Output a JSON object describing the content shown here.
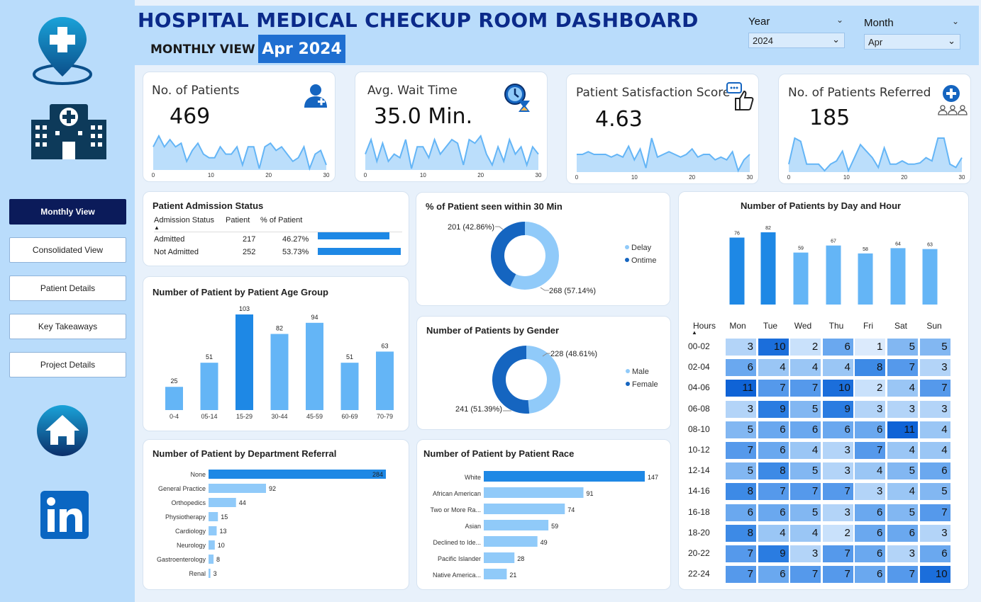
{
  "header": {
    "title": "HOSPITAL MEDICAL CHECKUP ROOM  DASHBOARD",
    "view_label": "MONTHLY VIEW",
    "period": "Apr 2024"
  },
  "filters": {
    "year": {
      "label": "Year",
      "value": "2024"
    },
    "month": {
      "label": "Month",
      "value": "Apr"
    }
  },
  "nav": {
    "items": [
      "Monthly View",
      "Consolidated View",
      "Patient Details",
      "Key Takeaways",
      "Project Details"
    ],
    "active": 0
  },
  "kpis": [
    {
      "title": "No. of Patients",
      "value": "469",
      "icon": "patient-icon",
      "ticks": [
        "0",
        "10",
        "20",
        "30"
      ]
    },
    {
      "title": "Avg. Wait Time",
      "value": "35.0 Min.",
      "icon": "clock-hourglass-icon",
      "ticks": [
        "0",
        "10",
        "20",
        "30"
      ]
    },
    {
      "title": "Patient Satisfaction Score",
      "value": "4.63",
      "icon": "feedback-thumbs-up-icon",
      "ticks": [
        "0",
        "10",
        "20",
        "30"
      ]
    },
    {
      "title": "No. of Patients Referred",
      "value": "185",
      "icon": "referral-group-icon",
      "ticks": [
        "0",
        "10",
        "20",
        "30"
      ]
    }
  ],
  "admission": {
    "title": "Patient Admission Status",
    "headers": [
      "Admission Status",
      "Patient",
      "% of Patient"
    ],
    "rows": [
      {
        "status": "Admitted",
        "patients": "217",
        "pct": "46.27%",
        "frac": 0.4627
      },
      {
        "status": "Not Admitted",
        "patients": "252",
        "pct": "53.73%",
        "frac": 0.5373
      }
    ]
  },
  "colors": {
    "dark": "#1565c0",
    "mid": "#1e88e5",
    "light": "#64b5f6",
    "lighter": "#90caf9",
    "pale": "#bbdefb"
  },
  "chart_data": [
    {
      "id": "kpi-patients",
      "type": "area",
      "x_range": [
        0,
        30
      ],
      "values": [
        6,
        7.5,
        6,
        7,
        6,
        6.5,
        4,
        5.5,
        6.5,
        5,
        4.5,
        4.5,
        6,
        5,
        5,
        6,
        3.5,
        6,
        6,
        3,
        6,
        6.5,
        5.5,
        6,
        5,
        4,
        4.5,
        6,
        3,
        5,
        5.5,
        3.5
      ]
    },
    {
      "id": "kpi-wait",
      "type": "area",
      "x_range": [
        0,
        30
      ],
      "values": [
        5,
        7,
        4,
        6.5,
        4,
        5,
        4.5,
        7,
        3,
        6,
        6,
        4.5,
        7,
        5,
        6,
        7,
        6.5,
        3.5,
        7,
        6.5,
        7.5,
        5,
        3.5,
        6,
        4,
        7,
        5,
        6,
        3.5,
        6,
        5
      ]
    },
    {
      "id": "kpi-satisfaction",
      "type": "area",
      "x_range": [
        0,
        30
      ],
      "values": [
        4.6,
        4.6,
        4.65,
        4.6,
        4.6,
        4.6,
        4.55,
        4.6,
        4.55,
        4.75,
        4.5,
        4.7,
        4.35,
        4.9,
        4.55,
        4.6,
        4.65,
        4.6,
        4.55,
        4.6,
        4.7,
        4.55,
        4.6,
        4.6,
        4.5,
        4.55,
        4.5,
        4.65,
        4.3,
        4.5,
        4.6
      ]
    },
    {
      "id": "kpi-referred",
      "type": "area",
      "x_range": [
        0,
        30
      ],
      "values": [
        3,
        7,
        6.5,
        3,
        3,
        3,
        2,
        3,
        3.5,
        5,
        2,
        4,
        6,
        5,
        4,
        2.5,
        5.5,
        3,
        3,
        3.5,
        3,
        3,
        3.2,
        4,
        3.5,
        7,
        7,
        3,
        2.5,
        4
      ]
    },
    {
      "id": "seen-30min",
      "type": "pie",
      "title": "% of Patient seen within 30 Min",
      "slices": [
        {
          "name": "Delay",
          "value": 268,
          "label": "268 (57.14%)"
        },
        {
          "name": "Ontime",
          "value": 201,
          "label": "201 (42.86%)"
        }
      ]
    },
    {
      "id": "gender",
      "type": "pie",
      "title": "Number of Patients by Gender",
      "slices": [
        {
          "name": "Male",
          "value": 228,
          "label": "228 (48.61%)"
        },
        {
          "name": "Female",
          "value": 241,
          "label": "241 (51.39%)"
        }
      ]
    },
    {
      "id": "age-group",
      "type": "bar",
      "title": "Number of Patient by Patient Age Group",
      "categories": [
        "0-4",
        "05-14",
        "15-29",
        "30-44",
        "45-59",
        "60-69",
        "70-79"
      ],
      "values": [
        25,
        51,
        103,
        82,
        94,
        51,
        63
      ]
    },
    {
      "id": "dept-referral",
      "type": "bar",
      "orientation": "horizontal",
      "title": "Number of Patient by Department Referral",
      "categories": [
        "None",
        "General Practice",
        "Orthopedics",
        "Physiotherapy",
        "Cardiology",
        "Neurology",
        "Gastroenterology",
        "Renal"
      ],
      "values": [
        284,
        92,
        44,
        15,
        13,
        10,
        8,
        3
      ]
    },
    {
      "id": "race",
      "type": "bar",
      "orientation": "horizontal",
      "title": "Number of Patient by Patient Race",
      "categories": [
        "White",
        "African American",
        "Two or More Ra...",
        "Asian",
        "Declined to Ide...",
        "Pacific Islander",
        "Native America..."
      ],
      "values": [
        147,
        91,
        74,
        59,
        49,
        28,
        21
      ]
    },
    {
      "id": "day-bar",
      "type": "bar",
      "title": "Number of Patients by Day and Hour",
      "categories": [
        "Mon",
        "Tue",
        "Wed",
        "Thu",
        "Fri",
        "Sat",
        "Sun"
      ],
      "values": [
        76,
        82,
        59,
        67,
        58,
        64,
        63
      ]
    },
    {
      "id": "day-hour",
      "type": "heatmap",
      "x": [
        "Mon",
        "Tue",
        "Wed",
        "Thu",
        "Fri",
        "Sat",
        "Sun"
      ],
      "y": [
        "00-02",
        "02-04",
        "04-06",
        "06-08",
        "08-10",
        "10-12",
        "12-14",
        "14-16",
        "16-18",
        "18-20",
        "20-22",
        "22-24"
      ],
      "y_title": "Hours",
      "values": [
        [
          3,
          10,
          2,
          6,
          1,
          5,
          5
        ],
        [
          6,
          4,
          4,
          4,
          8,
          7,
          3
        ],
        [
          11,
          7,
          7,
          10,
          2,
          4,
          7
        ],
        [
          3,
          9,
          5,
          9,
          3,
          3,
          3
        ],
        [
          5,
          6,
          6,
          6,
          6,
          11,
          4
        ],
        [
          7,
          6,
          4,
          3,
          7,
          4,
          4
        ],
        [
          5,
          8,
          5,
          3,
          4,
          5,
          6
        ],
        [
          8,
          7,
          7,
          7,
          3,
          4,
          5
        ],
        [
          6,
          6,
          5,
          3,
          6,
          5,
          7
        ],
        [
          8,
          4,
          4,
          2,
          6,
          6,
          3
        ],
        [
          7,
          9,
          3,
          7,
          6,
          3,
          6
        ],
        [
          7,
          6,
          7,
          7,
          6,
          7,
          10
        ]
      ]
    }
  ]
}
